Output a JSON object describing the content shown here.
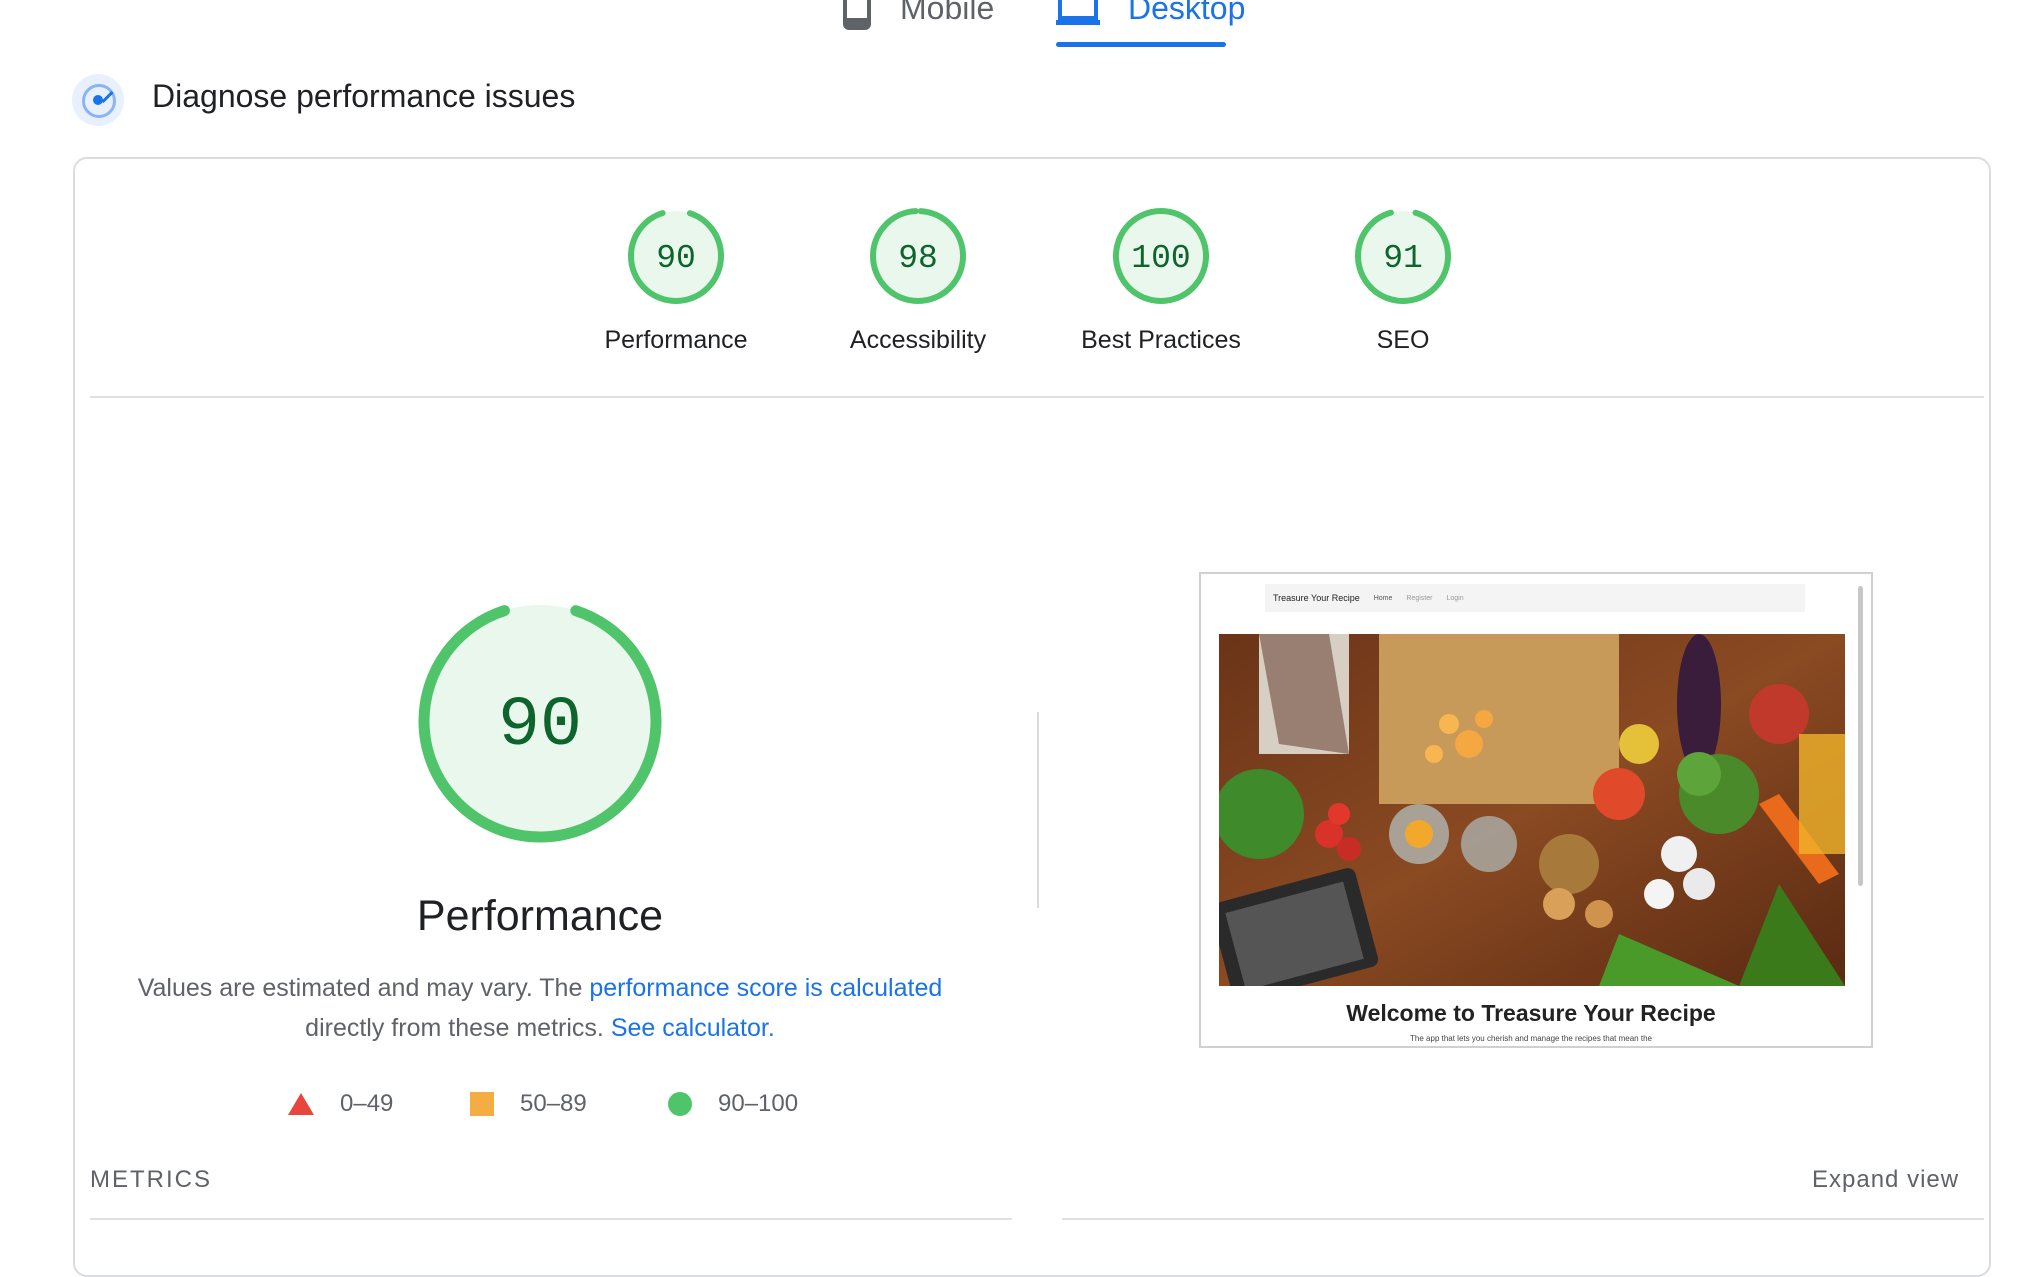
{
  "device_tabs": [
    {
      "label": "Mobile",
      "icon": "phone-icon",
      "active": false
    },
    {
      "label": "Desktop",
      "icon": "laptop-icon",
      "active": true
    }
  ],
  "section": {
    "title": "Diagnose performance issues",
    "icon": "gauge-icon"
  },
  "categories": [
    {
      "score": 90,
      "label": "Performance"
    },
    {
      "score": 98,
      "label": "Accessibility"
    },
    {
      "score": 100,
      "label": "Best Practices"
    },
    {
      "score": 91,
      "label": "SEO"
    }
  ],
  "performance": {
    "score": 90,
    "title": "Performance",
    "desc_prefix": "Values are estimated and may vary. The ",
    "desc_link": "performance score is calculated",
    "desc_middle": " directly from these metrics. ",
    "desc_link2": "See calculator."
  },
  "legend": [
    {
      "range": "0–49",
      "shape": "triangle",
      "color": "#e8453c"
    },
    {
      "range": "50–89",
      "shape": "square",
      "color": "#f4ad42"
    },
    {
      "range": "90–100",
      "shape": "circle",
      "color": "#4fc46a"
    }
  ],
  "screenshot": {
    "brand": "Treasure Your Recipe",
    "nav": [
      "Home",
      "Register",
      "Login"
    ],
    "heading": "Welcome to Treasure Your Recipe",
    "subtext": "The app that lets you cherish and manage the recipes that mean the"
  },
  "metrics": {
    "label": "METRICS",
    "expand": "Expand view"
  },
  "colors": {
    "pass": "#4fc46a",
    "pass_text": "#0d652d",
    "pass_bg": "#eaf7ed",
    "accent": "#1a73e8"
  }
}
